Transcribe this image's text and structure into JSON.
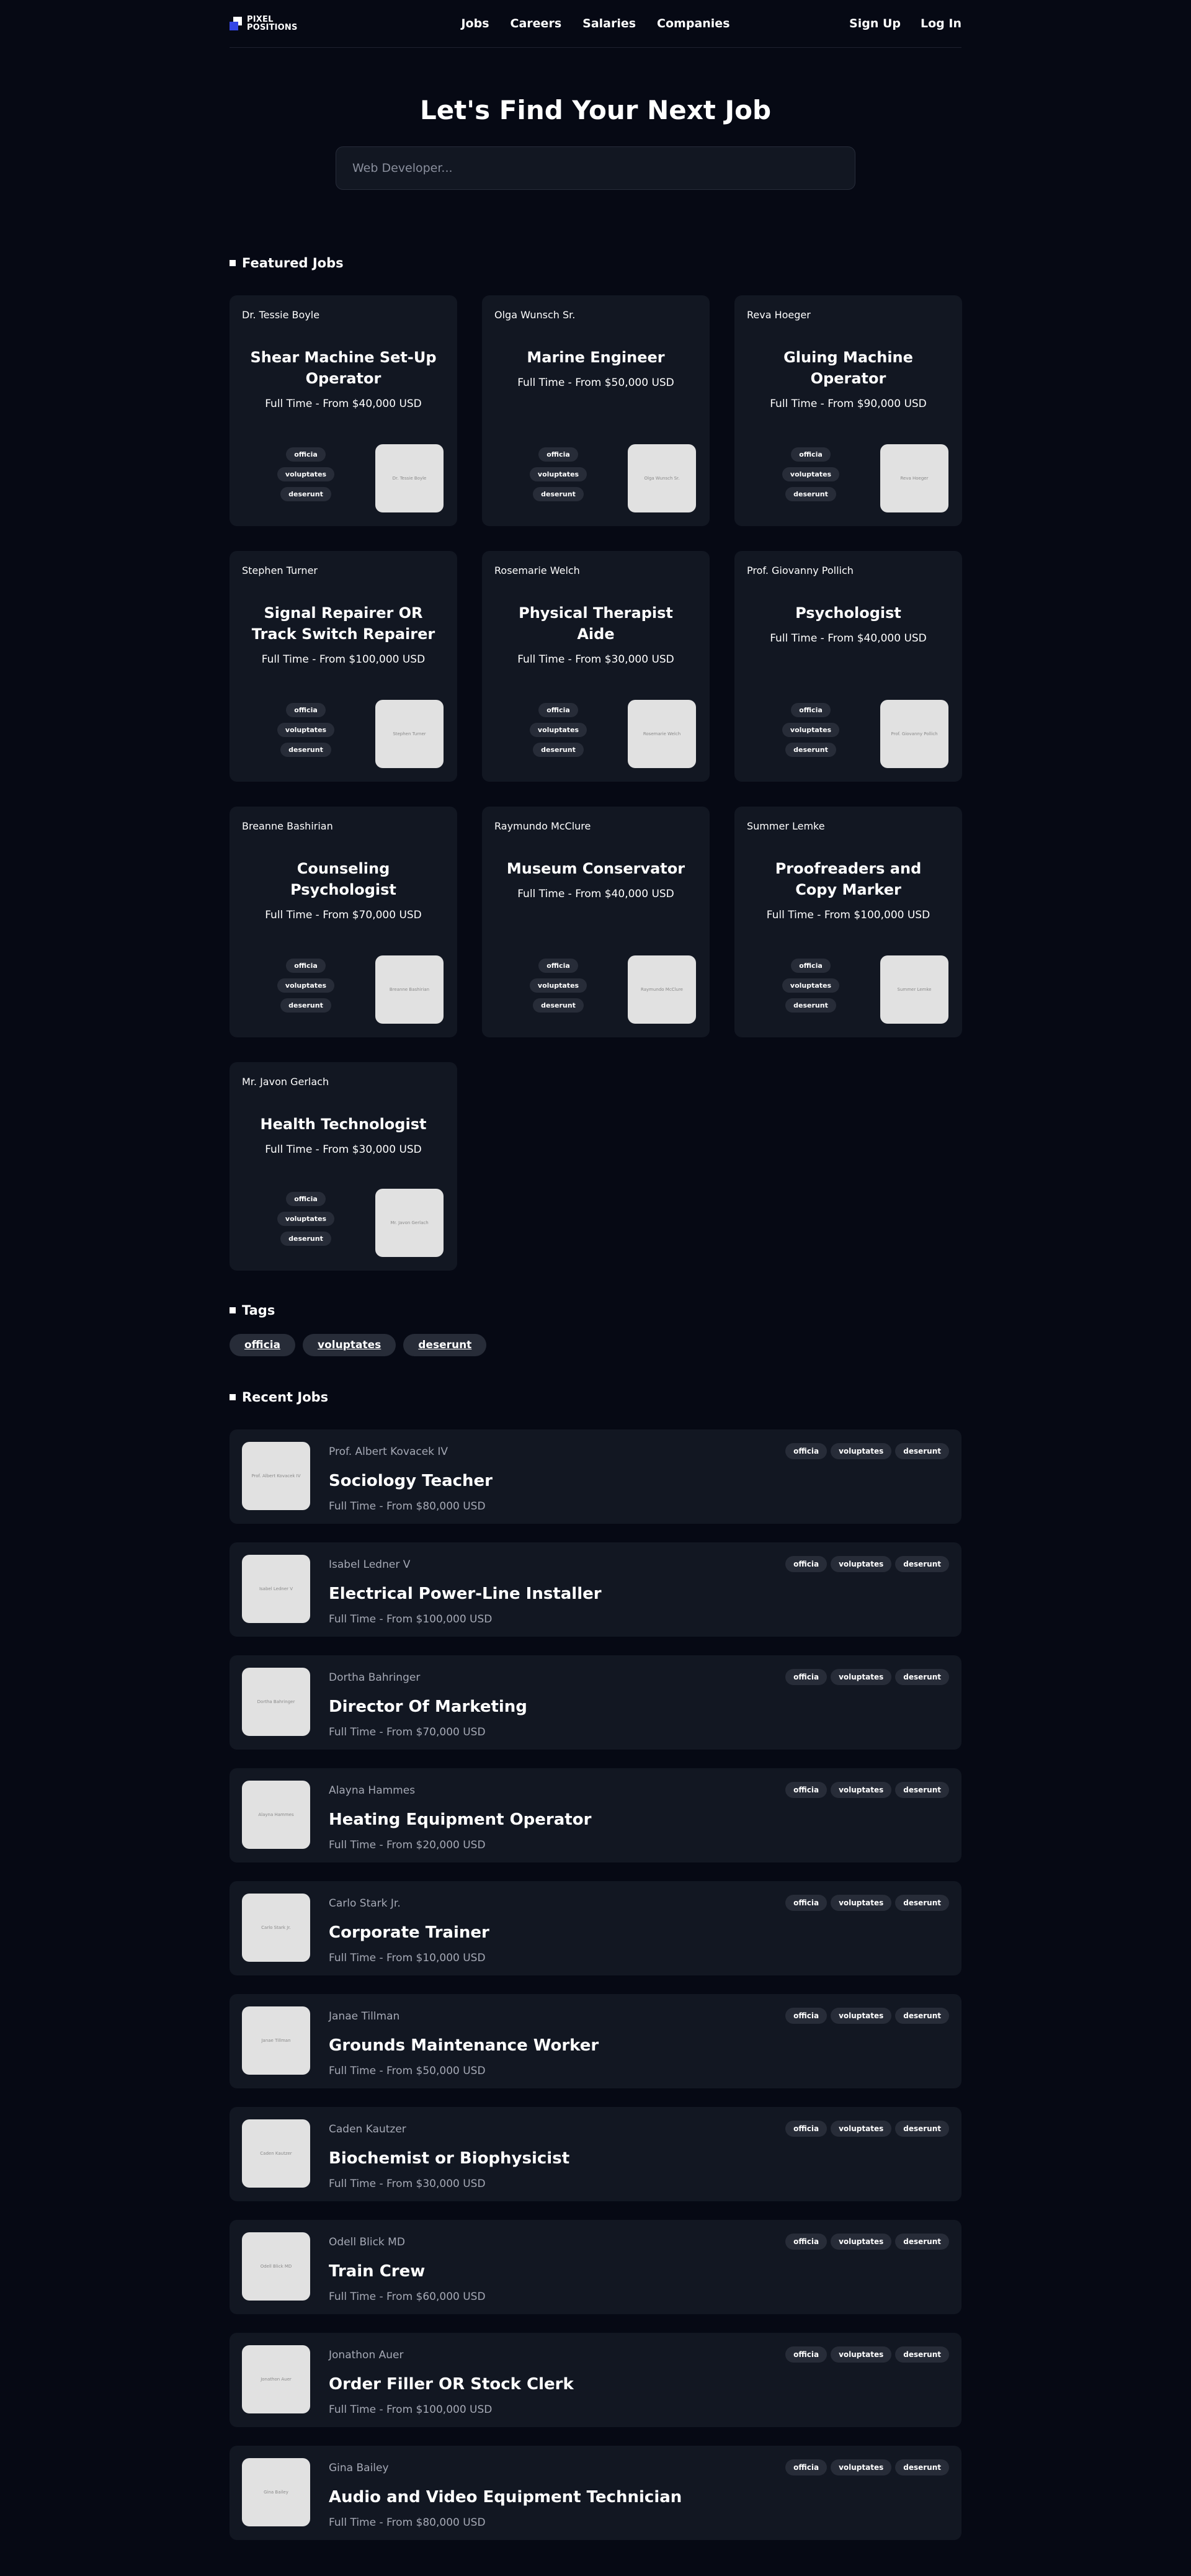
{
  "brand": {
    "line1": "PIXEL",
    "line2": "POSITIONS"
  },
  "nav": {
    "links": [
      "Jobs",
      "Careers",
      "Salaries",
      "Companies"
    ],
    "right": [
      "Sign Up",
      "Log In"
    ]
  },
  "hero": {
    "title": "Let's Find Your Next Job",
    "search_placeholder": "Web Developer..."
  },
  "featured": {
    "title": "Featured Jobs",
    "jobs": [
      {
        "employer": "Dr. Tessie Boyle",
        "title": "Shear Machine Set-Up Operator",
        "sub": "Full Time - From $40,000 USD",
        "logo": "Dr. Tessie Boyle",
        "tags": [
          "officia",
          "voluptates",
          "deserunt"
        ]
      },
      {
        "employer": "Olga Wunsch Sr.",
        "title": "Marine Engineer",
        "sub": "Full Time - From $50,000 USD",
        "logo": "Olga Wunsch Sr.",
        "tags": [
          "officia",
          "voluptates",
          "deserunt"
        ]
      },
      {
        "employer": "Reva Hoeger",
        "title": "Gluing Machine Operator",
        "sub": "Full Time - From $90,000 USD",
        "logo": "Reva Hoeger",
        "tags": [
          "officia",
          "voluptates",
          "deserunt"
        ]
      },
      {
        "employer": "Stephen Turner",
        "title": "Signal Repairer OR Track Switch Repairer",
        "sub": "Full Time - From $100,000 USD",
        "logo": "Stephen Turner",
        "tags": [
          "officia",
          "voluptates",
          "deserunt"
        ]
      },
      {
        "employer": "Rosemarie Welch",
        "title": "Physical Therapist Aide",
        "sub": "Full Time - From $30,000 USD",
        "logo": "Rosemarie Welch",
        "tags": [
          "officia",
          "voluptates",
          "deserunt"
        ]
      },
      {
        "employer": "Prof. Giovanny Pollich",
        "title": "Psychologist",
        "sub": "Full Time - From $40,000 USD",
        "logo": "Prof. Giovanny Pollich",
        "tags": [
          "officia",
          "voluptates",
          "deserunt"
        ]
      },
      {
        "employer": "Breanne Bashirian",
        "title": "Counseling Psychologist",
        "sub": "Full Time - From $70,000 USD",
        "logo": "Breanne Bashirian",
        "tags": [
          "officia",
          "voluptates",
          "deserunt"
        ]
      },
      {
        "employer": "Raymundo McClure",
        "title": "Museum Conservator",
        "sub": "Full Time - From $40,000 USD",
        "logo": "Raymundo McClure",
        "tags": [
          "officia",
          "voluptates",
          "deserunt"
        ]
      },
      {
        "employer": "Summer Lemke",
        "title": "Proofreaders and Copy Marker",
        "sub": "Full Time - From $100,000 USD",
        "logo": "Summer Lemke",
        "tags": [
          "officia",
          "voluptates",
          "deserunt"
        ]
      },
      {
        "employer": "Mr. Javon Gerlach",
        "title": "Health Technologist",
        "sub": "Full Time - From $30,000 USD",
        "logo": "Mr. Javon Gerlach",
        "tags": [
          "officia",
          "voluptates",
          "deserunt"
        ]
      }
    ]
  },
  "tags_section": {
    "title": "Tags",
    "tags": [
      "officia",
      "voluptates",
      "deserunt"
    ]
  },
  "recent": {
    "title": "Recent Jobs",
    "jobs": [
      {
        "employer": "Prof. Albert Kovacek IV",
        "title": "Sociology Teacher",
        "sub": "Full Time - From $80,000 USD",
        "logo": "Prof. Albert Kovacek IV",
        "tags": [
          "officia",
          "voluptates",
          "deserunt"
        ]
      },
      {
        "employer": "Isabel Ledner V",
        "title": "Electrical Power-Line Installer",
        "sub": "Full Time - From $100,000 USD",
        "logo": "Isabel Ledner V",
        "tags": [
          "officia",
          "voluptates",
          "deserunt"
        ]
      },
      {
        "employer": "Dortha Bahringer",
        "title": "Director Of Marketing",
        "sub": "Full Time - From $70,000 USD",
        "logo": "Dortha Bahringer",
        "tags": [
          "officia",
          "voluptates",
          "deserunt"
        ]
      },
      {
        "employer": "Alayna Hammes",
        "title": "Heating Equipment Operator",
        "sub": "Full Time - From $20,000 USD",
        "logo": "Alayna Hammes",
        "tags": [
          "officia",
          "voluptates",
          "deserunt"
        ]
      },
      {
        "employer": "Carlo Stark Jr.",
        "title": "Corporate Trainer",
        "sub": "Full Time - From $10,000 USD",
        "logo": "Carlo Stark Jr.",
        "tags": [
          "officia",
          "voluptates",
          "deserunt"
        ]
      },
      {
        "employer": "Janae Tillman",
        "title": "Grounds Maintenance Worker",
        "sub": "Full Time - From $50,000 USD",
        "logo": "Janae Tillman",
        "tags": [
          "officia",
          "voluptates",
          "deserunt"
        ]
      },
      {
        "employer": "Caden Kautzer",
        "title": "Biochemist or Biophysicist",
        "sub": "Full Time - From $30,000 USD",
        "logo": "Caden Kautzer",
        "tags": [
          "officia",
          "voluptates",
          "deserunt"
        ]
      },
      {
        "employer": "Odell Blick MD",
        "title": "Train Crew",
        "sub": "Full Time - From $60,000 USD",
        "logo": "Odell Blick MD",
        "tags": [
          "officia",
          "voluptates",
          "deserunt"
        ]
      },
      {
        "employer": "Jonathon Auer",
        "title": "Order Filler OR Stock Clerk",
        "sub": "Full Time - From $100,000 USD",
        "logo": "Jonathon Auer",
        "tags": [
          "officia",
          "voluptates",
          "deserunt"
        ]
      },
      {
        "employer": "Gina Bailey",
        "title": "Audio and Video Equipment Technician",
        "sub": "Full Time - From $80,000 USD",
        "logo": "Gina Bailey",
        "tags": [
          "officia",
          "voluptates",
          "deserunt"
        ]
      }
    ]
  }
}
